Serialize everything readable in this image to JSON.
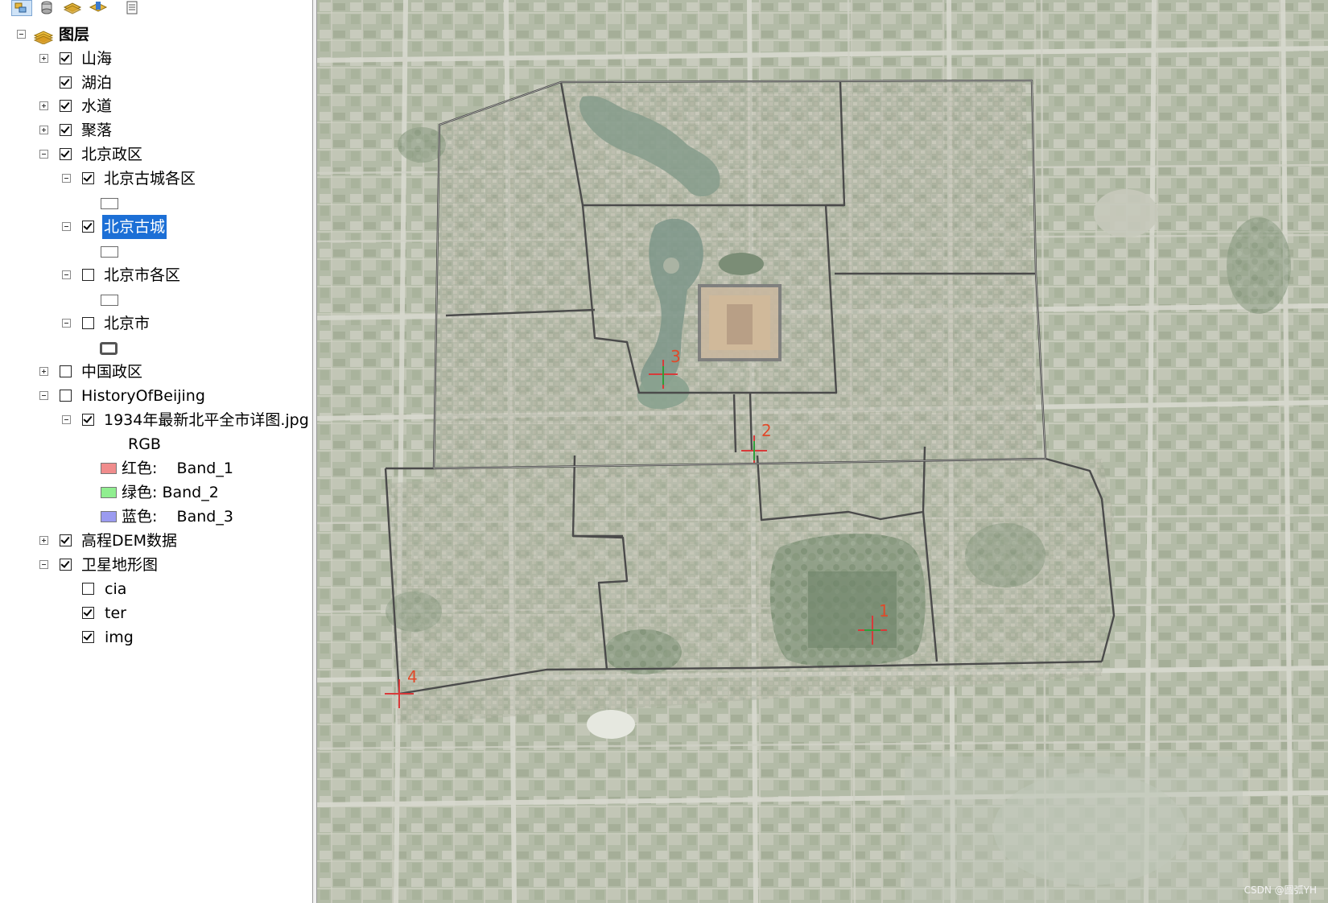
{
  "toc": {
    "toolbar_buttons": [
      "list-by-drawing-order-icon",
      "list-by-source-icon",
      "list-by-visibility-icon",
      "list-by-selection-icon",
      "options-icon"
    ],
    "root_label": "图层",
    "layers": [
      {
        "id": "shanhai",
        "label": "山海",
        "checked": true,
        "expander": "plus"
      },
      {
        "id": "hubo",
        "label": "湖泊",
        "checked": true,
        "expander": "none"
      },
      {
        "id": "shuidao",
        "label": "水道",
        "checked": true,
        "expander": "plus"
      },
      {
        "id": "juluo",
        "label": "聚落",
        "checked": true,
        "expander": "plus"
      },
      {
        "id": "beijing_zhengqu",
        "label": "北京政区",
        "checked": true,
        "expander": "minus"
      },
      {
        "id": "gucheng_gequ",
        "label": "北京古城各区",
        "checked": true,
        "expander": "minus"
      },
      {
        "id": "gucheng",
        "label": "北京古城",
        "checked": true,
        "expander": "minus",
        "selected": true
      },
      {
        "id": "shi_gequ",
        "label": "北京市各区",
        "checked": false,
        "expander": "minus"
      },
      {
        "id": "beijingshi",
        "label": "北京市",
        "checked": false,
        "expander": "minus"
      },
      {
        "id": "zhongguo",
        "label": "中国政区",
        "checked": false,
        "expander": "plus"
      },
      {
        "id": "history",
        "label": "HistoryOfBeijing",
        "checked": false,
        "expander": "minus"
      },
      {
        "id": "jpg1934",
        "label": "1934年最新北平全市详图.jpg",
        "checked": true,
        "expander": "minus"
      },
      {
        "id": "dem",
        "label": "高程DEM数据",
        "checked": true,
        "expander": "plus"
      },
      {
        "id": "satellite",
        "label": "卫星地形图",
        "checked": true,
        "expander": "minus"
      },
      {
        "id": "cia",
        "label": "cia",
        "checked": false,
        "expander": "none"
      },
      {
        "id": "ter",
        "label": "ter",
        "checked": true,
        "expander": "none"
      },
      {
        "id": "img",
        "label": "img",
        "checked": true,
        "expander": "none"
      }
    ],
    "rgb_label": "RGB",
    "bands": [
      {
        "label": "红色:    Band_1",
        "color": "#f08c8c"
      },
      {
        "label": "绿色: Band_2",
        "color": "#90ee90"
      },
      {
        "label": "蓝色:    Band_3",
        "color": "#9b9bf0"
      }
    ]
  },
  "map": {
    "control_points": [
      "1",
      "2",
      "3",
      "4"
    ],
    "point_color": "#e03030",
    "watermark": "CSDN @圆弧YH"
  }
}
